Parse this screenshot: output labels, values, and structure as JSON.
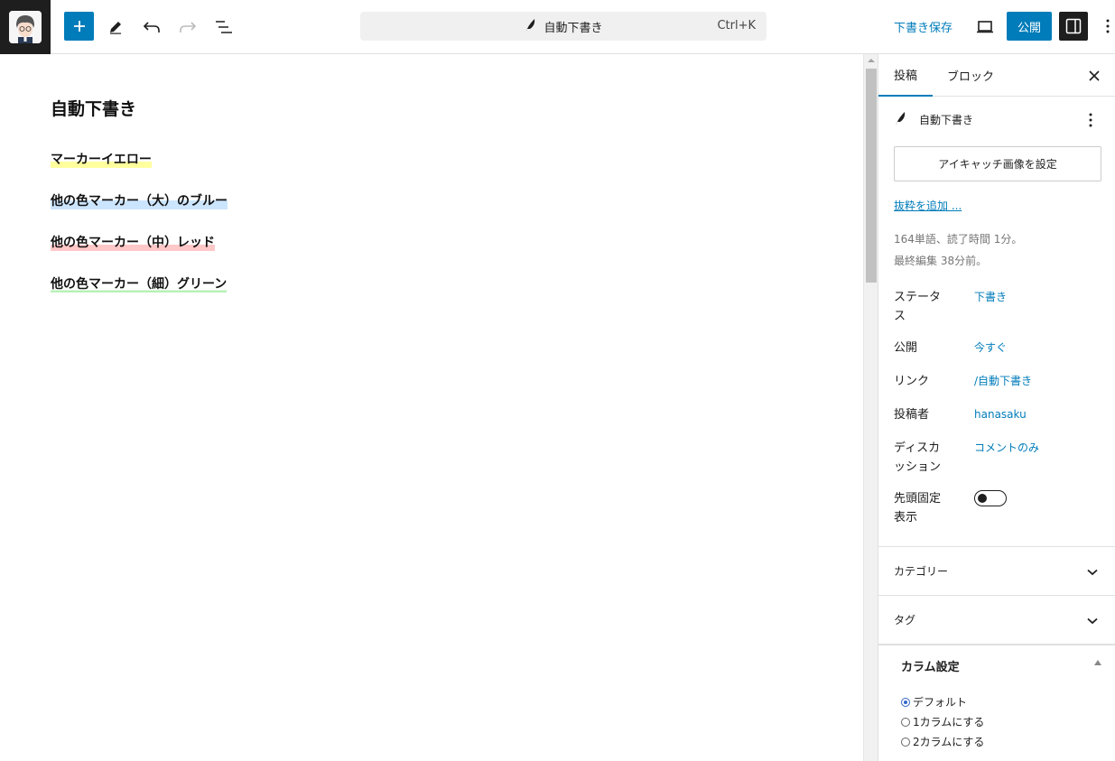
{
  "toolbar": {
    "command_title": "自動下書き",
    "command_shortcut": "Ctrl+K",
    "save_draft_label": "下書き保存",
    "publish_label": "公開"
  },
  "editor": {
    "title": "自動下書き",
    "paragraphs": [
      {
        "text": "マーカーイエロー",
        "marker": "yellow"
      },
      {
        "text": "他の色マーカー（大）のブルー",
        "marker": "blue"
      },
      {
        "text": "他の色マーカー（中）レッド",
        "marker": "red"
      },
      {
        "text": "他の色マーカー（細）グリーン",
        "marker": "green"
      }
    ]
  },
  "sidebar": {
    "tabs": [
      {
        "label": "投稿",
        "active": true
      },
      {
        "label": "ブロック",
        "active": false
      }
    ],
    "post_title": "自動下書き",
    "featured_image_label": "アイキャッチ画像を設定",
    "excerpt_link": "抜粋を追加 ...",
    "meta": {
      "word_count": "164単語、読了時間 1分。",
      "last_edited": "最終編集 38分前。"
    },
    "rows": [
      {
        "label": "ステータス",
        "value": "下書き"
      },
      {
        "label": "公開",
        "value": "今すぐ"
      },
      {
        "label": "リンク",
        "value": "/自動下書き"
      },
      {
        "label": "投稿者",
        "value": "hanasaku"
      },
      {
        "label": "ディスカッション",
        "value": "コメントのみ"
      },
      {
        "label": "先頭固定表示",
        "value": ""
      }
    ],
    "sticky_enabled": false,
    "panels": [
      {
        "label": "カテゴリー"
      },
      {
        "label": "タグ"
      }
    ],
    "column_settings": {
      "title": "カラム設定",
      "options": [
        {
          "label": "デフォルト",
          "checked": true
        },
        {
          "label": "1カラムにする",
          "checked": false
        },
        {
          "label": "2カラムにする",
          "checked": false
        }
      ]
    }
  },
  "colors": {
    "accent": "#007cba",
    "dark": "#1e1e1e",
    "marker_yellow": "#ffff9e",
    "marker_blue": "#cce5ff",
    "marker_red": "#ffc8c8",
    "marker_green": "#b8f0b8"
  },
  "icons": [
    "avatar",
    "plus-icon",
    "pen-icon",
    "undo-icon",
    "redo-icon",
    "list-view-icon",
    "feather-icon",
    "desktop-preview-icon",
    "sidebar-icon",
    "kebab-icon",
    "close-icon",
    "chevron-down-icon",
    "triangle-up-icon"
  ]
}
